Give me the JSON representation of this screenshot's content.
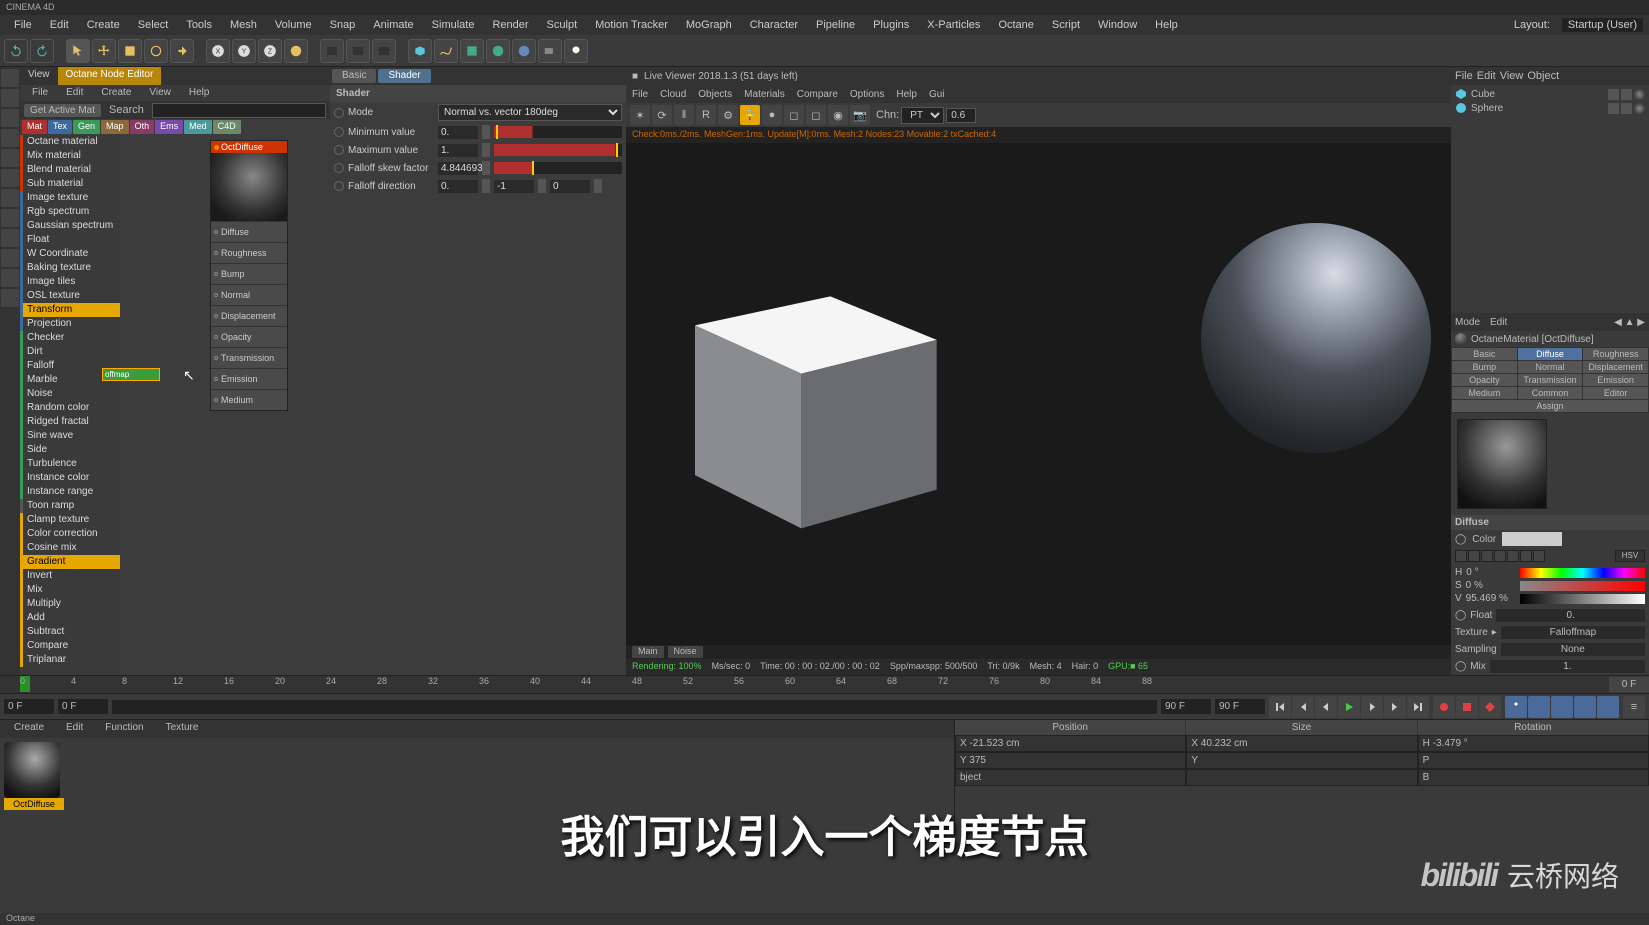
{
  "app_title": "CINEMA 4D",
  "main_menu": [
    "File",
    "Edit",
    "Create",
    "Select",
    "Tools",
    "Mesh",
    "Volume",
    "Snap",
    "Animate",
    "Simulate",
    "Render",
    "Sculpt",
    "Motion Tracker",
    "MoGraph",
    "Character",
    "Pipeline",
    "Plugins",
    "X-Particles",
    "Octane",
    "Script",
    "Window",
    "Help"
  ],
  "layout_label": "Layout:",
  "layout_value": "Startup (User)",
  "node_editor": {
    "tabs": [
      "View",
      "Octane Node Editor"
    ],
    "menu": [
      "File",
      "Edit",
      "Create",
      "View",
      "Help"
    ],
    "get_active": "Get Active Mat",
    "search_label": "Search",
    "filters": [
      {
        "label": "Mat",
        "color": "#b03030"
      },
      {
        "label": "Tex",
        "color": "#3a6aa0"
      },
      {
        "label": "Gen",
        "color": "#3a9a5a"
      },
      {
        "label": "Map",
        "color": "#8a6a3a"
      },
      {
        "label": "Oth",
        "color": "#8a3a6a"
      },
      {
        "label": "Ems",
        "color": "#7a4aaa"
      },
      {
        "label": "Med",
        "color": "#4a9a9a"
      },
      {
        "label": "C4D",
        "color": "#6a8a6a"
      }
    ],
    "categories": [
      {
        "color": "#cc3300",
        "items": [
          "Octane material",
          "Mix material",
          "Blend material",
          "Sub material"
        ]
      },
      {
        "color": "#3a6aa0",
        "items": [
          "Image texture",
          "Rgb spectrum",
          "Gaussian spectrum",
          "Float",
          "W Coordinate",
          "Baking texture",
          "Image tiles",
          "OSL texture",
          "Transform",
          "Projection"
        ]
      },
      {
        "color": "#3a9a5a",
        "items": [
          "Checker",
          "Dirt",
          "Falloff",
          "Marble",
          "Noise",
          "Random color",
          "Ridged fractal",
          "Sine wave",
          "Side",
          "Turbulence",
          "Instance color",
          "Instance range"
        ]
      },
      {
        "color": "#555",
        "items": [
          "Toon ramp"
        ]
      },
      {
        "color": "#e6a800",
        "items": [
          "Clamp texture",
          "Color correction",
          "Cosine mix",
          "Gradient",
          "Invert",
          "Mix",
          "Multiply",
          "Add",
          "Subtract",
          "Compare",
          "Triplanar"
        ]
      }
    ],
    "highlight_items": [
      "Transform",
      "Gradient"
    ],
    "node": {
      "title": "OctDiffuse",
      "slots": [
        "Diffuse",
        "Roughness",
        "Bump",
        "Normal",
        "Displacement",
        "Opacity",
        "Transmission",
        "Emission",
        "Medium"
      ]
    },
    "drag_node": "offmap"
  },
  "shader_panel": {
    "tabs": [
      "Basic",
      "Shader"
    ],
    "title": "Shader",
    "rows": {
      "mode": {
        "label": "Mode",
        "value": "Normal vs. vector 180deg"
      },
      "min": {
        "label": "Minimum value",
        "value": "0."
      },
      "max": {
        "label": "Maximum value",
        "value": "1."
      },
      "skew": {
        "label": "Falloff skew factor",
        "value": "4.844693"
      },
      "dir": {
        "label": "Falloff direction",
        "x": "0.",
        "y": "-1",
        "z": "0"
      }
    }
  },
  "viewer": {
    "title": "Live Viewer 2018.1.3  (51 days left)",
    "menu": [
      "File",
      "Cloud",
      "Objects",
      "Materials",
      "Compare",
      "Options",
      "Help",
      "Gui"
    ],
    "chn_label": "Chn:",
    "chn_value": "PT",
    "chn_num": "0.6",
    "status": "Check:0ms./2ms. MeshGen:1ms. Update[M]:0ms. Mesh:2 Nodes:23 Movable:2 txCached:4",
    "tabs": [
      "Main",
      "Noise"
    ],
    "footer": {
      "rendering": "Rendering: 100%",
      "ms": "Ms/sec: 0",
      "time": "Time:  00 : 00 : 02./00 : 00 : 02",
      "spp": "Spp/maxspp: 500/500",
      "tri": "Tri: 0/9k",
      "mesh": "Mesh: 4",
      "hair": "Hair: 0",
      "gpu": "GPU:■  65"
    }
  },
  "objects": {
    "menu": [
      "File",
      "Edit",
      "View",
      "Object"
    ],
    "items": [
      {
        "name": "Cube",
        "icon": "#5ac8e0"
      },
      {
        "name": "Sphere",
        "icon": "#5ac8e0"
      }
    ]
  },
  "attr_panel": {
    "menu": [
      "Mode",
      "Edit"
    ],
    "title": "OctaneMaterial [OctDiffuse]",
    "tabs": [
      "Basic",
      "Diffuse",
      "Roughness",
      "Bump",
      "Normal",
      "Displacement",
      "Opacity",
      "Transmission",
      "Emission",
      "Medium",
      "Common",
      "Editor",
      "Assign"
    ],
    "active_tab": "Diffuse",
    "section": "Diffuse",
    "color_label": "Color",
    "hsv": {
      "h": "0 °",
      "s": "0 %",
      "v": "95.469 %"
    },
    "float_label": "Float",
    "float_val": "0.",
    "texture_label": "Texture",
    "texture_val": "Falloffmap",
    "sampling_label": "Sampling",
    "sampling_val": "None",
    "mix_label": "Mix",
    "mix_val": "1."
  },
  "timeline": {
    "ticks": [
      "0",
      "4",
      "8",
      "12",
      "16",
      "20",
      "24",
      "28",
      "32",
      "36",
      "40",
      "44",
      "48",
      "52",
      "56",
      "60",
      "64",
      "68",
      "72",
      "76",
      "80",
      "84",
      "88"
    ],
    "end": "0 F",
    "start_field": "0 F",
    "cur_field": "0 F",
    "end_field1": "90 F",
    "end_field2": "90 F"
  },
  "mat_manager": {
    "menu": [
      "Create",
      "Edit",
      "Function",
      "Texture"
    ],
    "thumb_name": "OctDiffuse"
  },
  "coords": {
    "headers": [
      "Position",
      "Size",
      "Rotation"
    ],
    "rows": [
      [
        "X  -21.523 cm",
        "X  40.232 cm",
        "H  -3.479 °"
      ],
      [
        "Y  375",
        "Y",
        "P"
      ],
      [
        "bject",
        "",
        "B"
      ]
    ]
  },
  "subtitle": "我们可以引入一个梯度节点",
  "watermark_brand": "bilibili",
  "watermark_text": "云桥网络",
  "status_bottom": "Octane"
}
